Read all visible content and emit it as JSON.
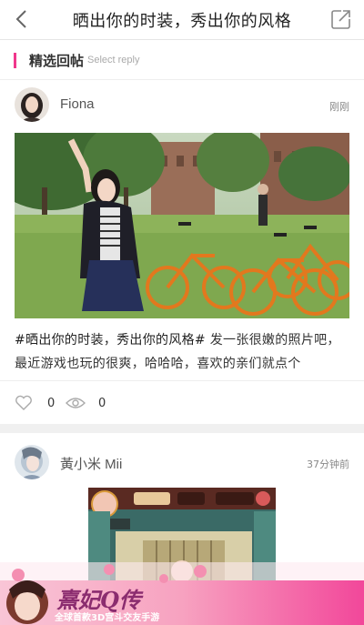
{
  "nav": {
    "title": "晒出你的时装，秀出你的风格",
    "back_icon": "chevron-left-icon",
    "share_icon": "share-icon"
  },
  "section": {
    "title": "精选回帖",
    "subtitle": "Select reply",
    "accent_color": "#f0378c"
  },
  "posts": [
    {
      "username": "Fiona",
      "time": "刚刚",
      "tag": "#晒出你的时装，秀出你的风格#",
      "text": "发一张很嫩的照片吧，最近游戏也玩的很爽，哈哈哈，喜欢的亲们就点个",
      "likes": "0",
      "views": "0"
    },
    {
      "username": "黃小米 Mii",
      "time": "37分钟前"
    }
  ],
  "ad": {
    "logo_text": "熹妃Q传",
    "slogan": "全球首款3D宫斗交友手游"
  }
}
